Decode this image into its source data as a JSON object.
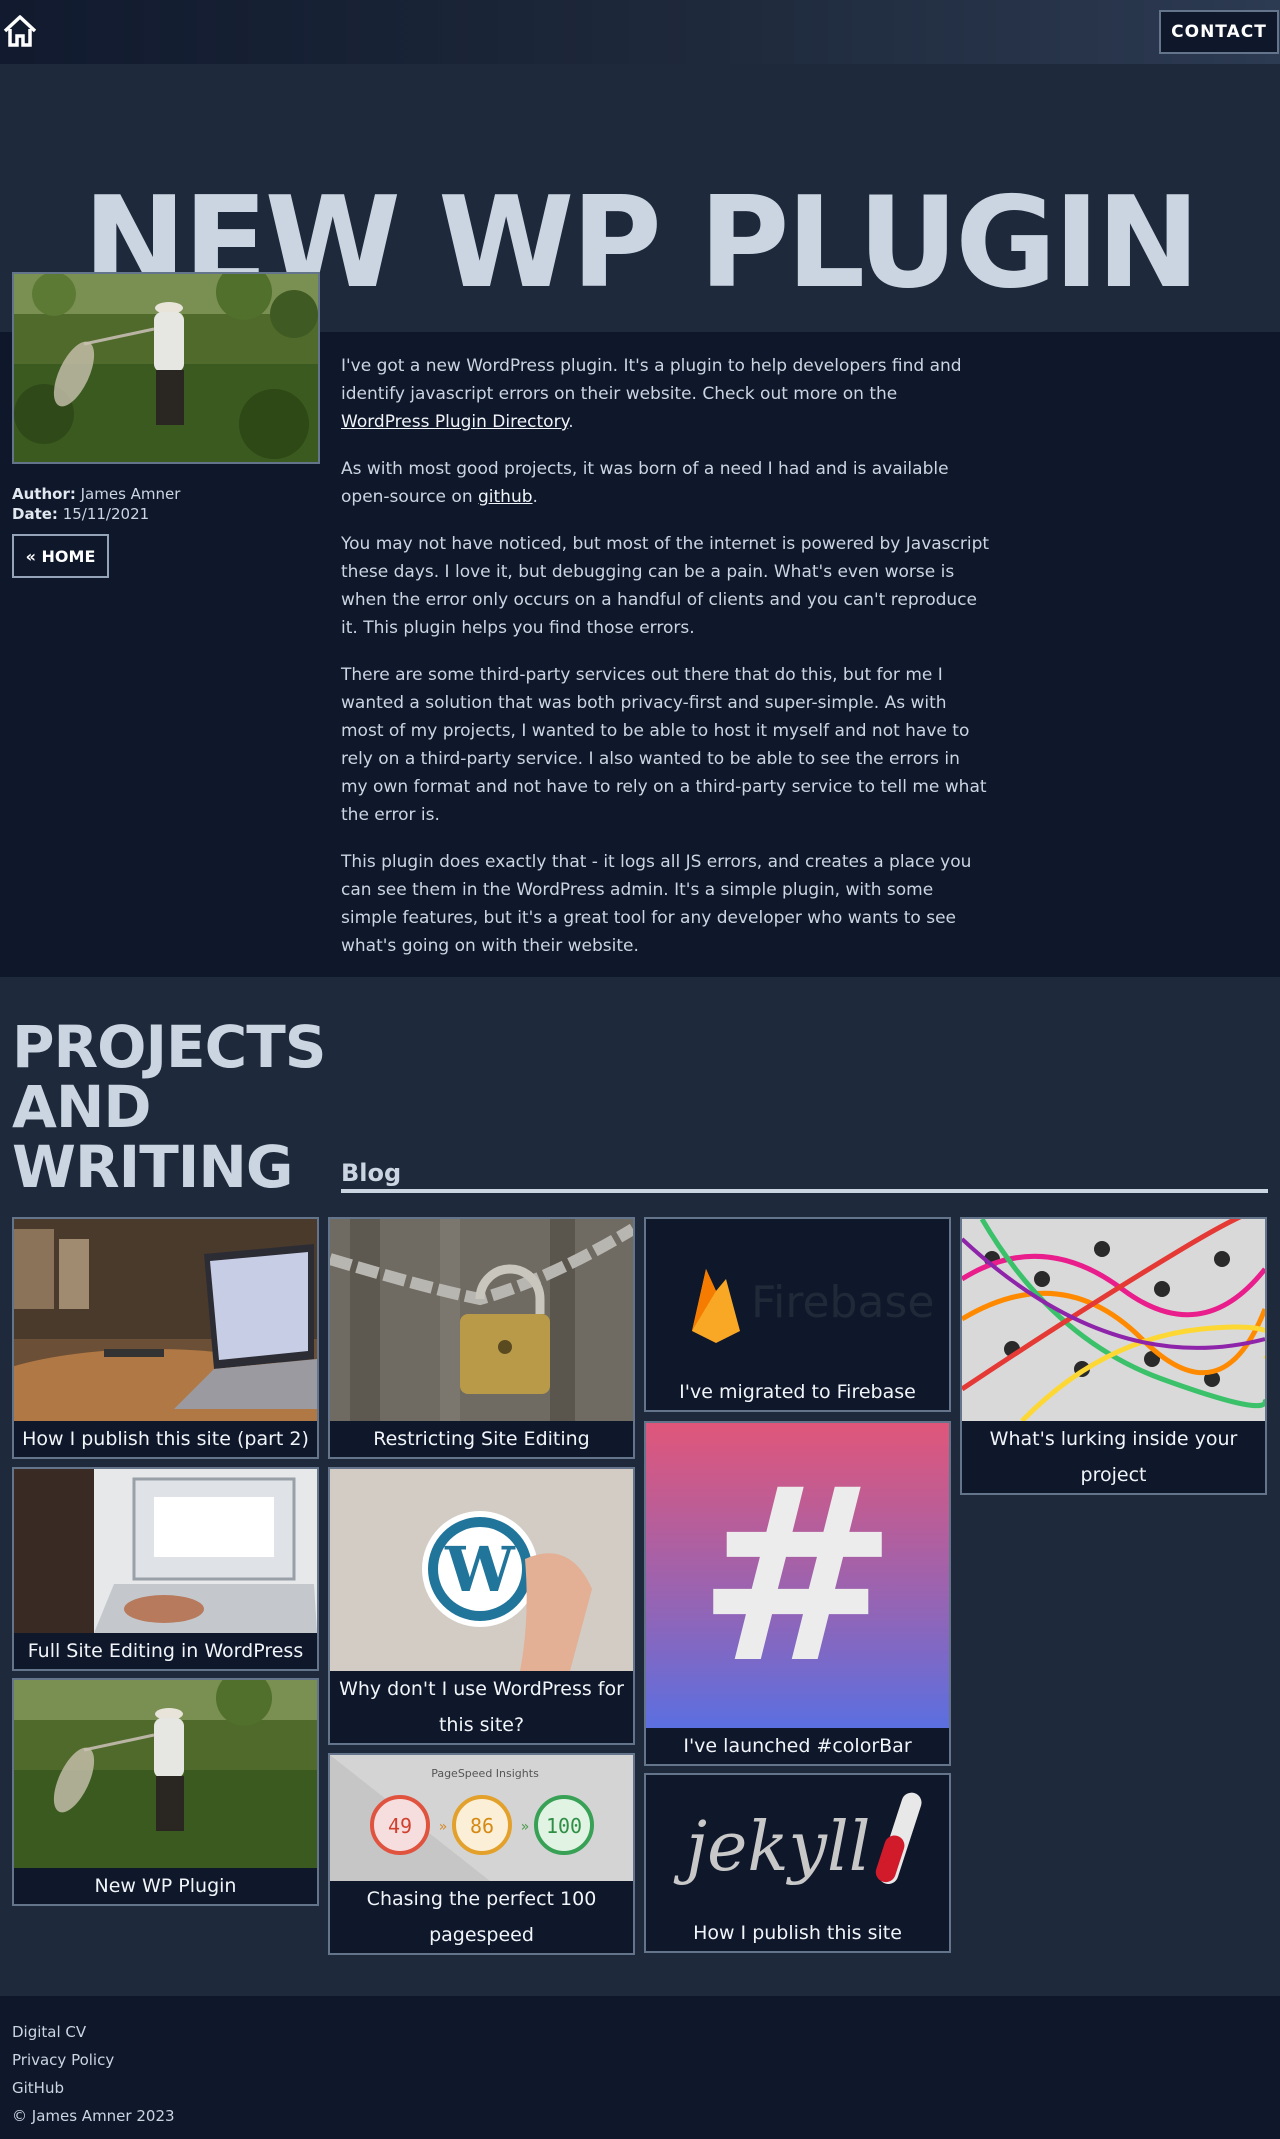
{
  "header": {
    "home_icon": "home-icon",
    "contact_label": "CONTACT"
  },
  "hero": {
    "title": "NEW WP PLUGIN"
  },
  "article": {
    "author_label": "Author:",
    "author": "James Amner",
    "date_label": "Date:",
    "date": "15/11/2021",
    "home_button": "« HOME",
    "p1_a": "I've got a new WordPress plugin. It's a plugin to help developers find and identify javascript errors on their website. Check out more on the ",
    "p1_link": "WordPress Plugin Directory",
    "p1_b": ".",
    "p2_a": "As with most good projects, it was born of a need I had and is available open-source on ",
    "p2_link": "github",
    "p2_b": ".",
    "p3": "You may not have noticed, but most of the internet is powered by Javascript these days. I love it, but debugging can be a pain. What's even worse is when the error only occurs on a handful of clients and you can't reproduce it. This plugin helps you find those errors.",
    "p4": "There are some third-party services out there that do this, but for me I wanted a solution that was both privacy-first and super-simple. As with most of my projects, I wanted to be able to host it myself and not have to rely on a third-party service. I also wanted to be able to see the errors in my own format and not have to rely on a third-party service to tell me what the error is.",
    "p5": "This plugin does exactly that - it logs all JS errors, and creates a place you can see them in the WordPress admin. It's a simple plugin, with some simple features, but it's a great tool for any developer who wants to see what's going on with their website."
  },
  "projects": {
    "title_line1": "PROJECTS",
    "title_line2": "AND",
    "title_line3": "WRITING",
    "blog_heading": "Blog",
    "cards": [
      {
        "label": "How I publish this site (part 2)"
      },
      {
        "label": "Full Site Editing in WordPress"
      },
      {
        "label": "New WP Plugin"
      },
      {
        "label": "Restricting Site Editing"
      },
      {
        "label": "Why don't I use WordPress for this site?"
      },
      {
        "label": "Chasing the perfect 100 pagespeed"
      },
      {
        "label": "I've migrated to Firebase"
      },
      {
        "label": "I've launched #colorBar"
      },
      {
        "label": "How I publish this site"
      },
      {
        "label": "What's lurking inside your project"
      }
    ],
    "firebase_logo_text": "Firebase",
    "colorbar_symbol": "#",
    "jekyll_logo_text": "jekyll",
    "pagespeed": {
      "title": "PageSpeed Insights",
      "scores": [
        "49",
        "86",
        "100"
      ],
      "arrow": "»"
    }
  },
  "footer": {
    "links": [
      "Digital CV",
      "Privacy Policy",
      "GitHub"
    ],
    "copyright": "© James Amner 2023"
  },
  "colors": {
    "background": "#0f172a",
    "panel": "#1e293b",
    "text": "#cbd5e1",
    "border": "#64748b"
  }
}
